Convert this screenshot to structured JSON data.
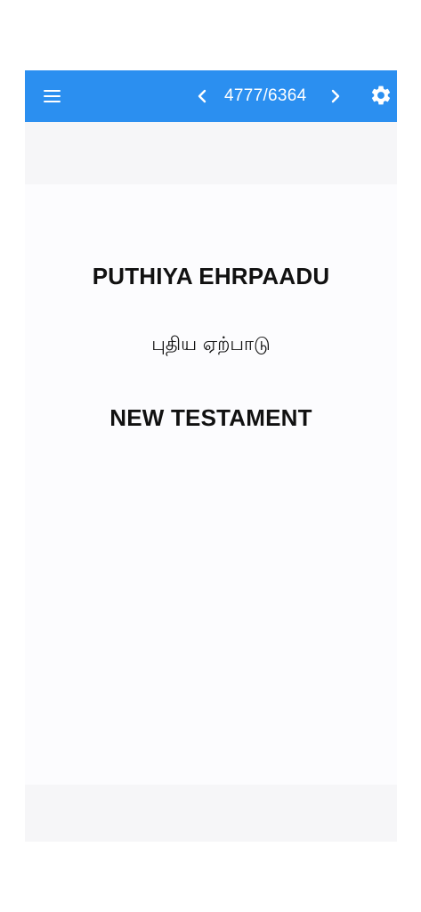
{
  "toolbar": {
    "page_counter": "4777/6364",
    "accent_color": "#2b8ff0",
    "menu_icon": "hamburger-menu-icon",
    "prev_icon": "chevron-left-icon",
    "next_icon": "chevron-right-icon",
    "settings_icon": "gear-icon"
  },
  "page": {
    "title_english": "PUTHIYA EHRPAADU",
    "title_tamil": "புதிய ஏற்பாடு",
    "subtitle": "NEW TESTAMENT"
  }
}
